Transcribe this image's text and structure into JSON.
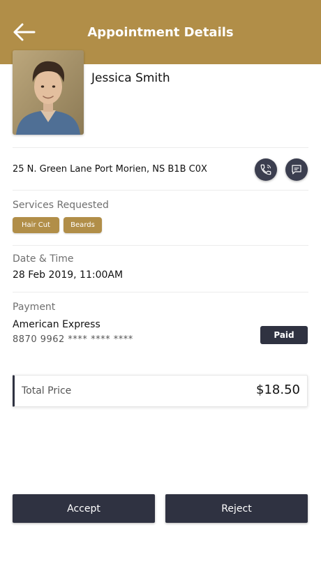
{
  "header": {
    "title": "Appointment Details",
    "back_icon": "arrow-left-icon",
    "background": "#b18e48"
  },
  "client": {
    "name": "Jessica Smith",
    "avatar_icon": "user-photo"
  },
  "location": {
    "address": "25 N. Green Lane Port Morien, NS B1B C0X",
    "call_icon": "phone-icon",
    "message_icon": "chat-icon"
  },
  "services": {
    "label": "Services Requested",
    "items": [
      "Hair Cut",
      "Beards"
    ]
  },
  "datetime": {
    "label": "Date & Time",
    "value": "28 Feb 2019, 11:00AM"
  },
  "payment": {
    "label": "Payment",
    "method": "American Express",
    "card": "8870 9962 **** **** ****",
    "status": "Paid"
  },
  "total": {
    "label": "Total Price",
    "value": "$18.50"
  },
  "actions": {
    "accept": "Accept",
    "reject": "Reject"
  },
  "colors": {
    "accent": "#b18e48",
    "dark": "#2f3241"
  }
}
